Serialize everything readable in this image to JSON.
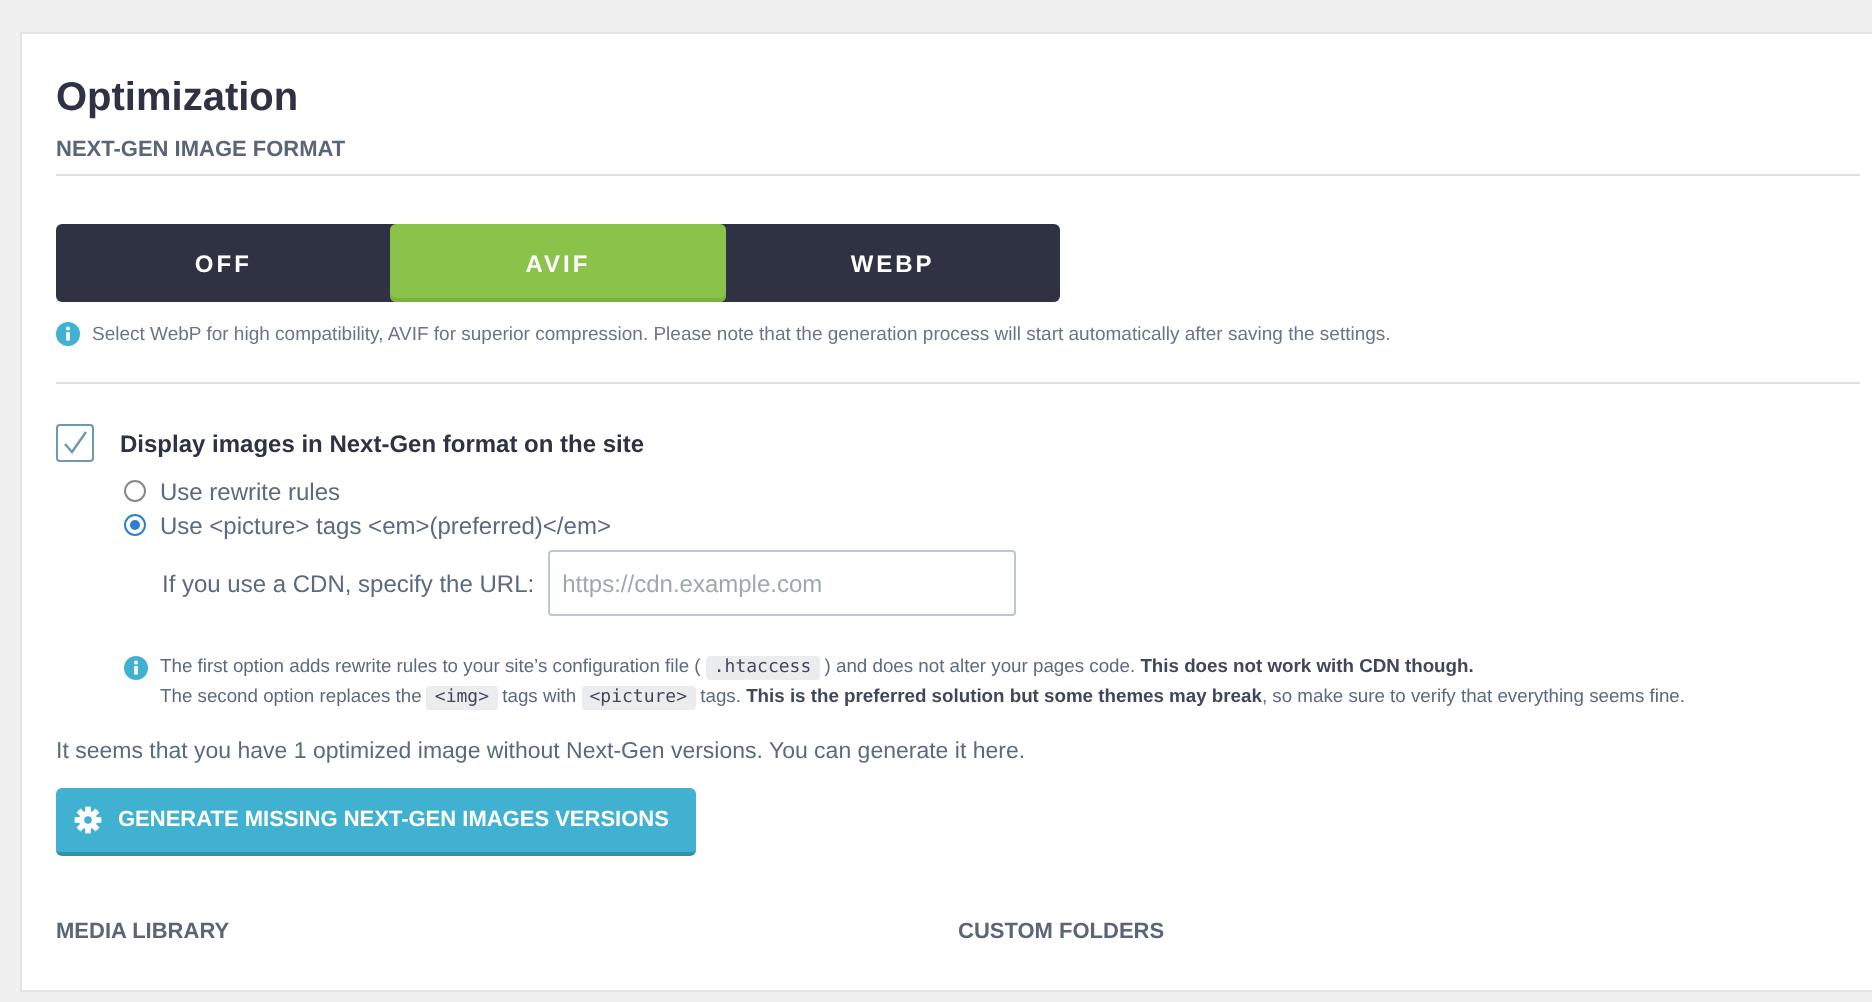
{
  "title": "Optimization",
  "section": "NEXT-GEN IMAGE FORMAT",
  "formats": [
    {
      "label": "OFF",
      "selected": false
    },
    {
      "label": "AVIF",
      "selected": true
    },
    {
      "label": "WEBP",
      "selected": false
    }
  ],
  "format_hint": "Select WebP for high compatibility, AVIF for superior compression. Please note that the generation process will start automatically after saving the settings.",
  "display_option": {
    "label": "Display images in Next-Gen format on the site",
    "checked": true
  },
  "methods": [
    {
      "label": "Use rewrite rules",
      "selected": false
    },
    {
      "label": "Use <picture> tags <em>(preferred)</em>",
      "selected": true
    }
  ],
  "cdn": {
    "label": "If you use a CDN, specify the URL:",
    "placeholder": "https://cdn.example.com"
  },
  "note_lines": [
    [
      {
        "kind": "text",
        "text": "The first option adds rewrite rules to your site’s configuration file ("
      },
      {
        "kind": "code",
        "text": ".htaccess"
      },
      {
        "kind": "text",
        "text": ") and does not alter your pages code. **This does not work with CDN though.**"
      }
    ],
    [
      {
        "kind": "text",
        "text": "The second option replaces the"
      },
      {
        "kind": "code",
        "text": "<img>"
      },
      {
        "kind": "text",
        "text": "tags with"
      },
      {
        "kind": "code",
        "text": "<picture>"
      },
      {
        "kind": "text",
        "text": "tags. **This is the preferred solution but some themes may break**, so make sure to verify that everything seems fine."
      }
    ]
  ],
  "message": "It seems that you have 1 optimized image without Next-Gen versions. You can generate it here.",
  "generate_button": "GENERATE MISSING NEXT-GEN IMAGES VERSIONS",
  "bottom_sections": [
    "MEDIA LIBRARY",
    "CUSTOM FOLDERS"
  ]
}
